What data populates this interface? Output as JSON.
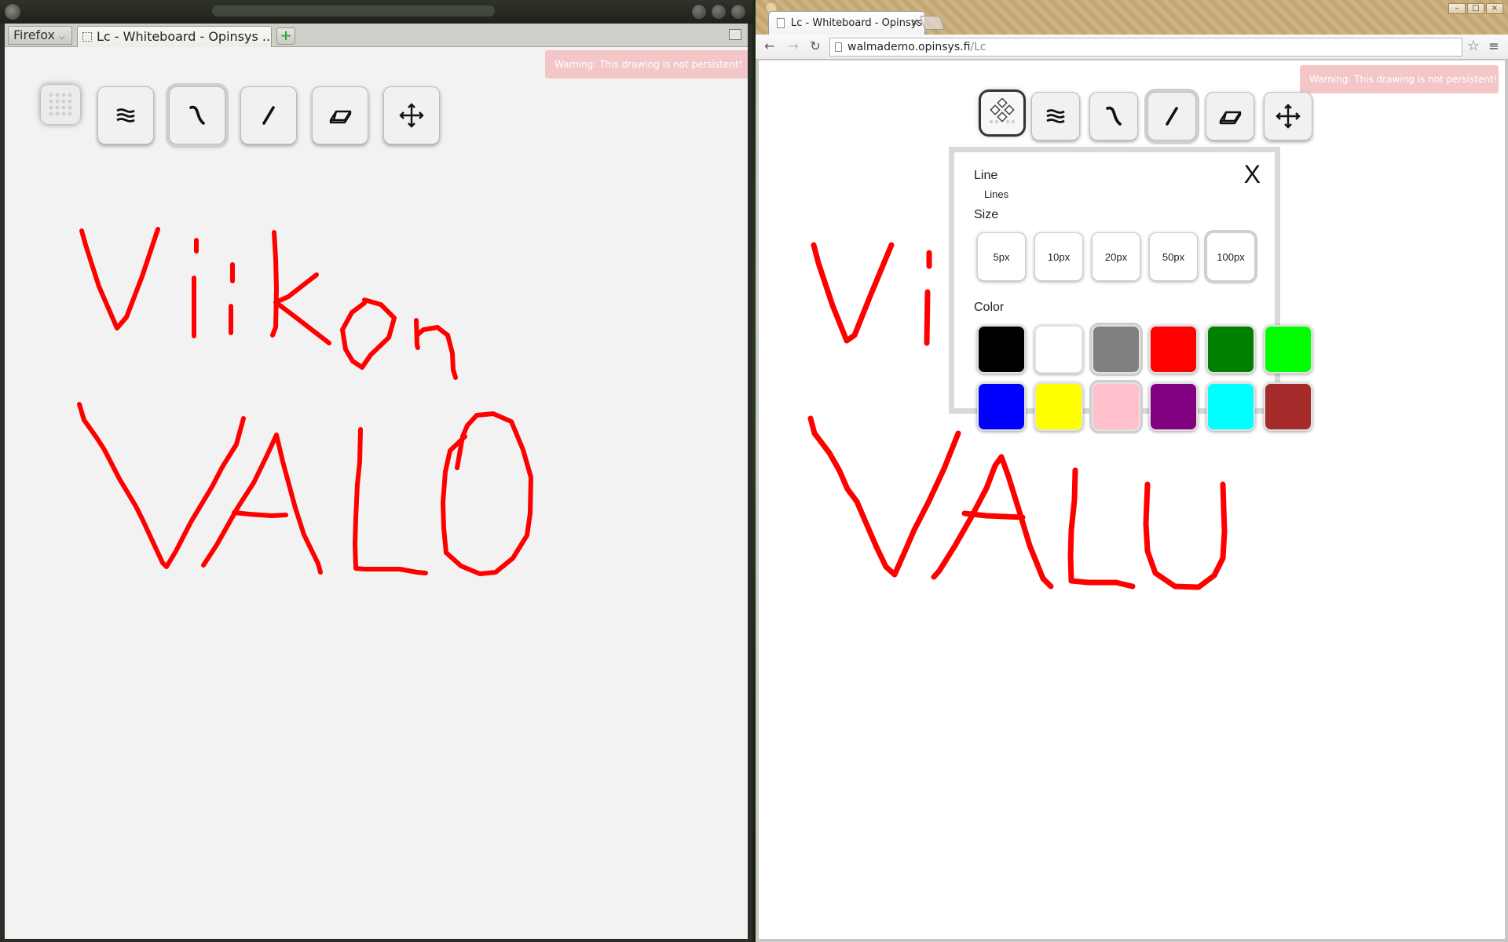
{
  "firefox": {
    "menu_label": "Firefox",
    "tab_title": "Lc - Whiteboard - Opinsys ...",
    "new_tab_symbol": "+"
  },
  "chromium": {
    "tab_title": "Lc - Whiteboard - Opinsys",
    "tab_close": "×",
    "url_host": "walmademo.opinsys.fi",
    "url_path": "/Lc",
    "nav_back": "←",
    "nav_forward": "→",
    "nav_reload": "↻",
    "star": "☆",
    "menu": "≡",
    "win_min": "–",
    "win_max": "□",
    "win_close": "×"
  },
  "whiteboard": {
    "warning": "Warning: This drawing is not persistent!",
    "tools": [
      {
        "name": "menu",
        "icon": "grid-dots-icon"
      },
      {
        "name": "settings",
        "icon": "wavy-lines-icon"
      },
      {
        "name": "freehand",
        "icon": "freehand-pen-icon"
      },
      {
        "name": "line",
        "icon": "straight-line-icon"
      },
      {
        "name": "eraser",
        "icon": "eraser-icon"
      },
      {
        "name": "move",
        "icon": "move-arrows-icon"
      }
    ],
    "selected_tool_left": "freehand",
    "selected_tool_right": "line",
    "drawing_text": [
      "Viikon",
      "VALO"
    ],
    "ink_color": "#ff0000"
  },
  "settings_panel": {
    "close_label": "X",
    "line_heading": "Line",
    "line_value": "Lines",
    "size_heading": "Size",
    "sizes": [
      "5px",
      "10px",
      "20px",
      "50px",
      "100px"
    ],
    "selected_size": "100px",
    "color_heading": "Color",
    "colors": [
      "#000000",
      "#ffffff",
      "#808080",
      "#ff0000",
      "#008000",
      "#00ff00",
      "#0000ff",
      "#ffff00",
      "#ffc0cb",
      "#800080",
      "#00ffff",
      "#a52a2a"
    ],
    "selected_colors": [
      "#808080",
      "#ffc0cb"
    ]
  }
}
